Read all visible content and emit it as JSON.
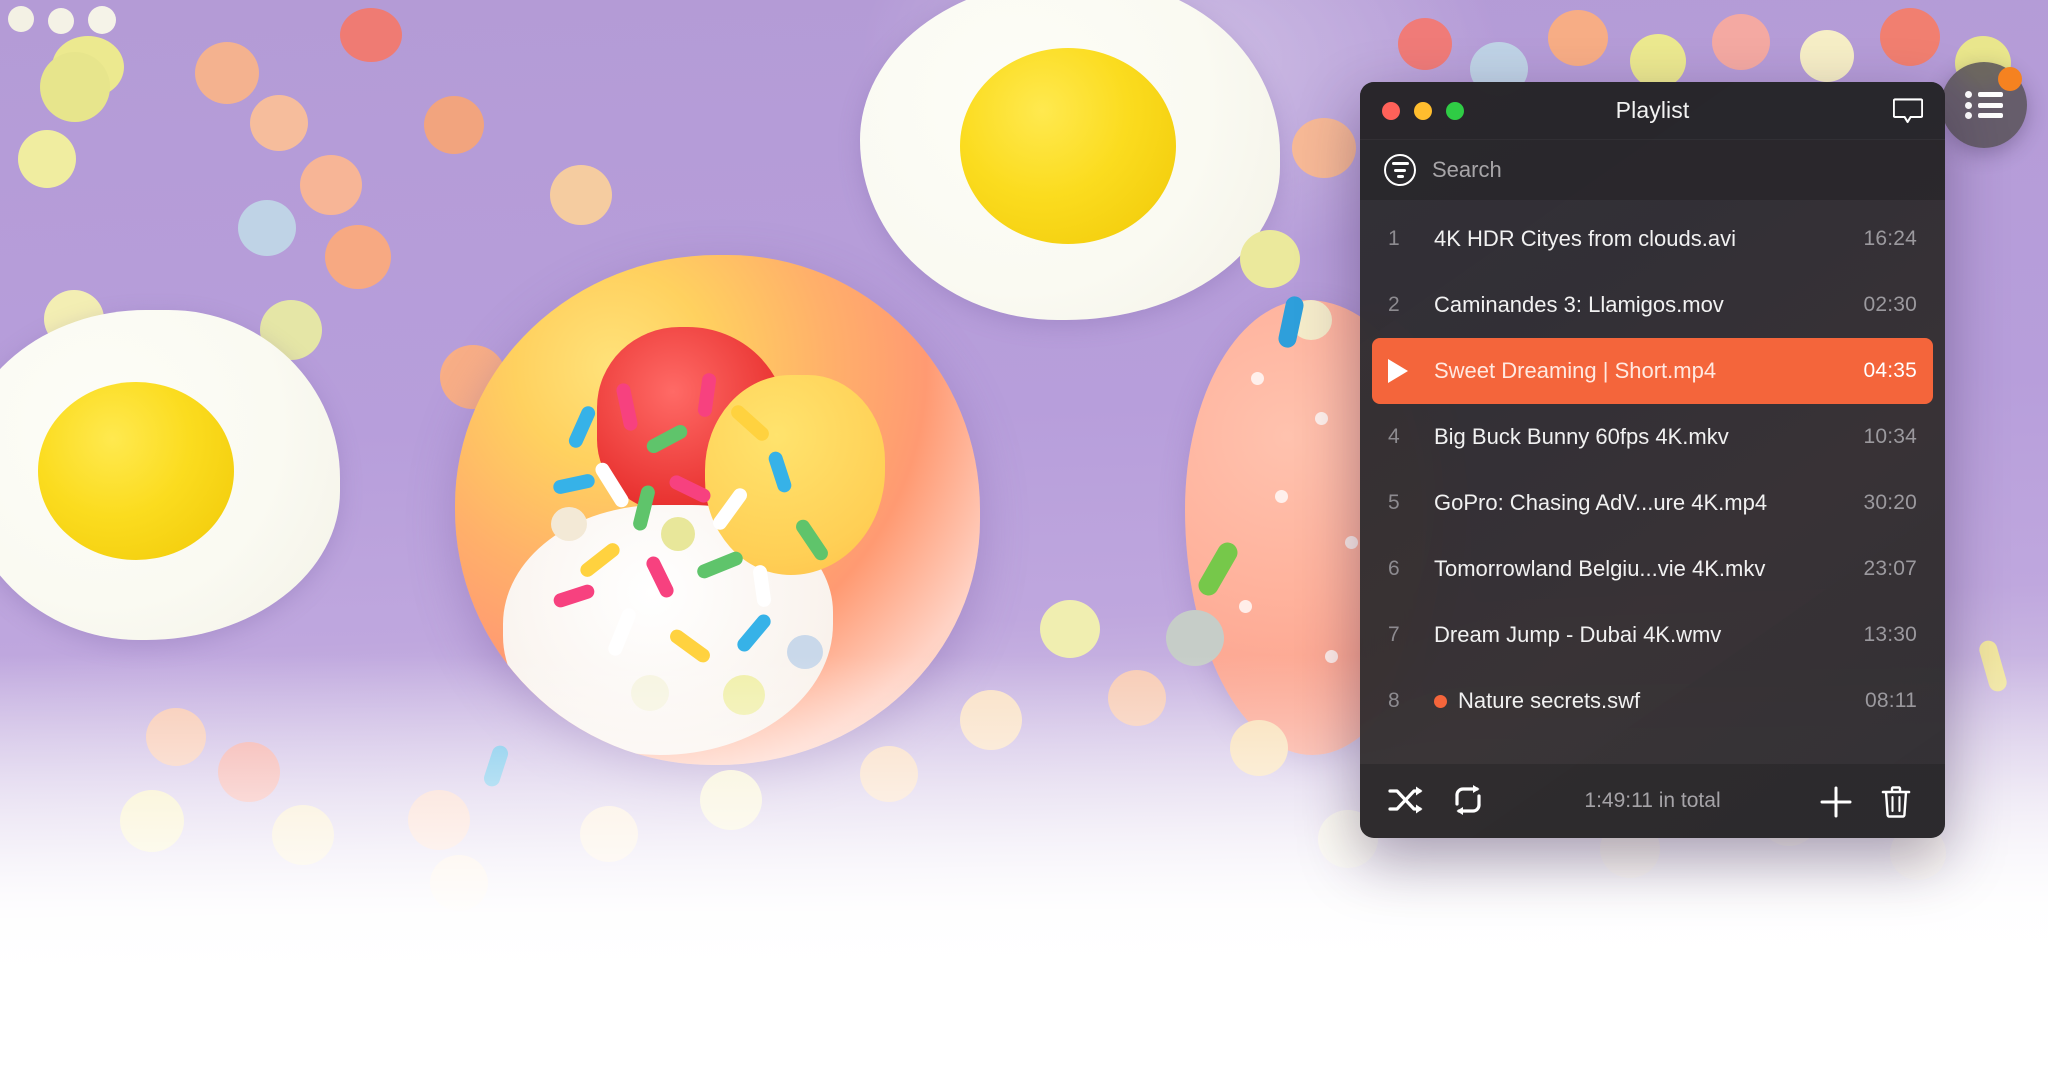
{
  "background": {
    "description": "photo-candy-eggs-purple",
    "base_color": "#b49bd6"
  },
  "floating_button": {
    "name": "playlist-toggle",
    "icon": "list-icon",
    "badge": true,
    "badge_color": "#f58220",
    "background_color": "#585358"
  },
  "panel": {
    "title": "Playlist",
    "window_controls": {
      "close": "close",
      "minimize": "minimize",
      "zoom": "zoom",
      "close_color": "#ff6159",
      "minimize_color": "#ffbd2e",
      "zoom_color": "#2fcc45"
    },
    "bubble_icon": "speech-bubble-icon",
    "search": {
      "placeholder": "Search",
      "icon": "filter-icon"
    },
    "accent_color": "#f4653b",
    "tracks": [
      {
        "num": "1",
        "name": "4K HDR Cityes from clouds.avi",
        "time": "16:24",
        "active": false,
        "flagged": false
      },
      {
        "num": "2",
        "name": "Caminandes 3: Llamigos.mov",
        "time": "02:30",
        "active": false,
        "flagged": false
      },
      {
        "num": "3",
        "name": "Sweet Dreaming | Short.mp4",
        "time": "04:35",
        "active": true,
        "flagged": false
      },
      {
        "num": "4",
        "name": "Big Buck Bunny 60fps 4K.mkv",
        "time": "10:34",
        "active": false,
        "flagged": false
      },
      {
        "num": "5",
        "name": "GoPro: Chasing AdV...ure 4K.mp4",
        "time": "30:20",
        "active": false,
        "flagged": false
      },
      {
        "num": "6",
        "name": "Tomorrowland Belgiu...vie 4K.mkv",
        "time": "23:07",
        "active": false,
        "flagged": false
      },
      {
        "num": "7",
        "name": "Dream Jump - Dubai 4K.wmv",
        "time": "13:30",
        "active": false,
        "flagged": false
      },
      {
        "num": "8",
        "name": "Nature secrets.swf",
        "time": "08:11",
        "active": false,
        "flagged": true
      }
    ],
    "footer": {
      "shuffle_icon": "shuffle-icon",
      "repeat_icon": "repeat-icon",
      "total": "1:49:11 in total",
      "add_icon": "plus-icon",
      "delete_icon": "trash-icon"
    }
  }
}
